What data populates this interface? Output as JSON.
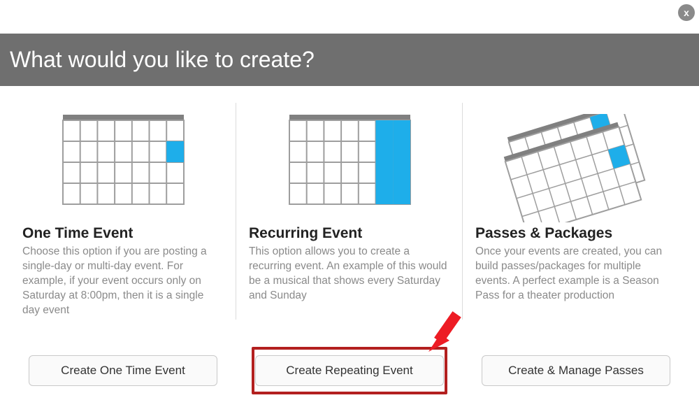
{
  "close_label": "x",
  "header": {
    "title": "What would you like to create?"
  },
  "options": [
    {
      "title": "One Time Event",
      "description": "Choose this option if you are posting a single-day or multi-day event. For example, if your event occurs only on Saturday at 8:00pm, then it is a single day event",
      "button_label": "Create One Time Event"
    },
    {
      "title": "Recurring Event",
      "description": "This option allows you to create a recurring event. An example of this would be a musical that shows every Saturday and Sunday",
      "button_label": "Create Repeating Event"
    },
    {
      "title": "Passes & Packages",
      "description": "Once your events are created, you can build passes/packages for multiple events. A perfect example is a Season Pass for a theater production",
      "button_label": "Create & Manage Passes"
    }
  ]
}
